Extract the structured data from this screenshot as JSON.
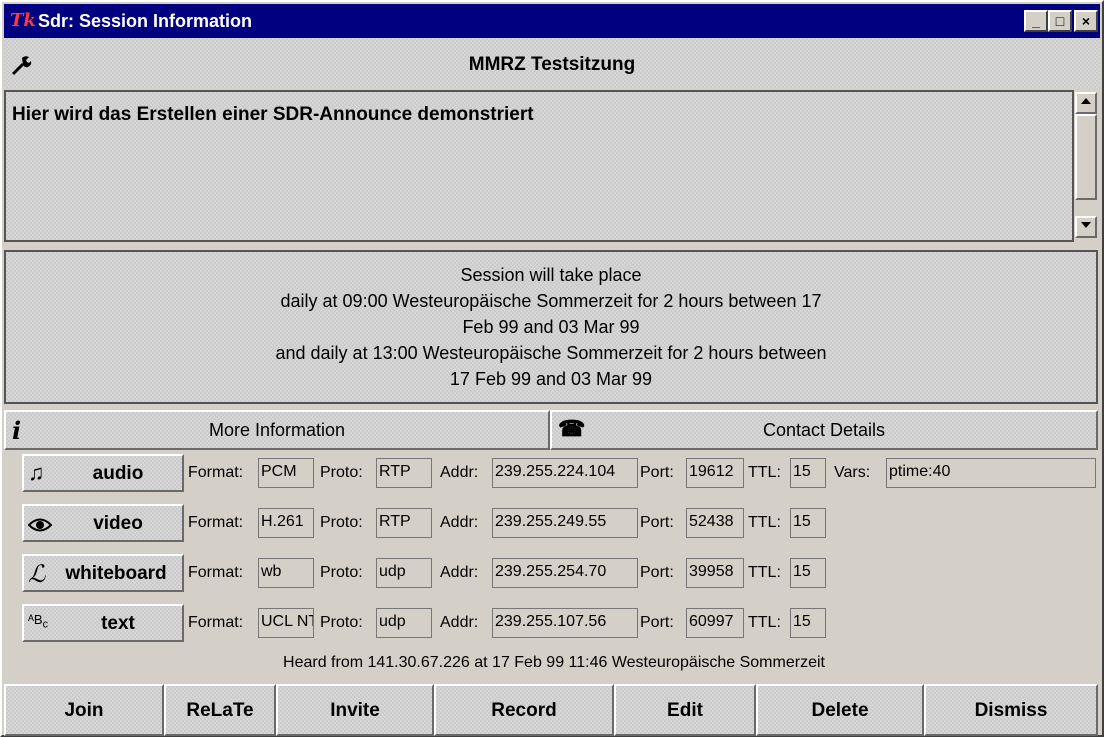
{
  "window": {
    "title": "Sdr: Session Information",
    "logo": "Tk",
    "minimize_glyph": "_",
    "maximize_glyph": "□",
    "close_glyph": "×"
  },
  "session": {
    "name": "MMRZ Testsitzung",
    "description": "Hier wird das Erstellen einer SDR-Announce demonstriert"
  },
  "schedule": {
    "lines": [
      "Session will take place",
      "daily at 09:00 Westeuropäische Sommerzeit for 2 hours between 17",
      "Feb 99 and 03 Mar 99",
      "and daily at 13:00 Westeuropäische Sommerzeit for 2 hours between",
      "17 Feb 99 and 03 Mar 99"
    ]
  },
  "info_bar": {
    "more_info_label": "More Information",
    "contact_label": "Contact Details"
  },
  "labels": {
    "format": "Format:",
    "proto": "Proto:",
    "addr": "Addr:",
    "port": "Port:",
    "ttl": "TTL:",
    "vars": "Vars:"
  },
  "media": [
    {
      "name": "audio",
      "icon": "music-note-icon",
      "format": "PCM",
      "proto": "RTP",
      "addr": "239.255.224.104",
      "port": "19612",
      "ttl": "15",
      "vars": "ptime:40"
    },
    {
      "name": "video",
      "icon": "eye-icon",
      "format": "H.261",
      "proto": "RTP",
      "addr": "239.255.249.55",
      "port": "52438",
      "ttl": "15"
    },
    {
      "name": "whiteboard",
      "icon": "pen-icon",
      "format": "wb",
      "proto": "udp",
      "addr": "239.255.254.70",
      "port": "39958",
      "ttl": "15"
    },
    {
      "name": "text",
      "icon": "abc-icon",
      "format": "UCL NT",
      "proto": "udp",
      "addr": "239.255.107.56",
      "port": "60997",
      "ttl": "15"
    }
  ],
  "heard_from": "Heard from 141.30.67.226 at 17 Feb 99 11:46 Westeuropäische Sommerzeit",
  "buttons": {
    "join": "Join",
    "relate": "ReLaTe",
    "invite": "Invite",
    "record": "Record",
    "edit": "Edit",
    "delete": "Delete",
    "dismiss": "Dismiss"
  }
}
